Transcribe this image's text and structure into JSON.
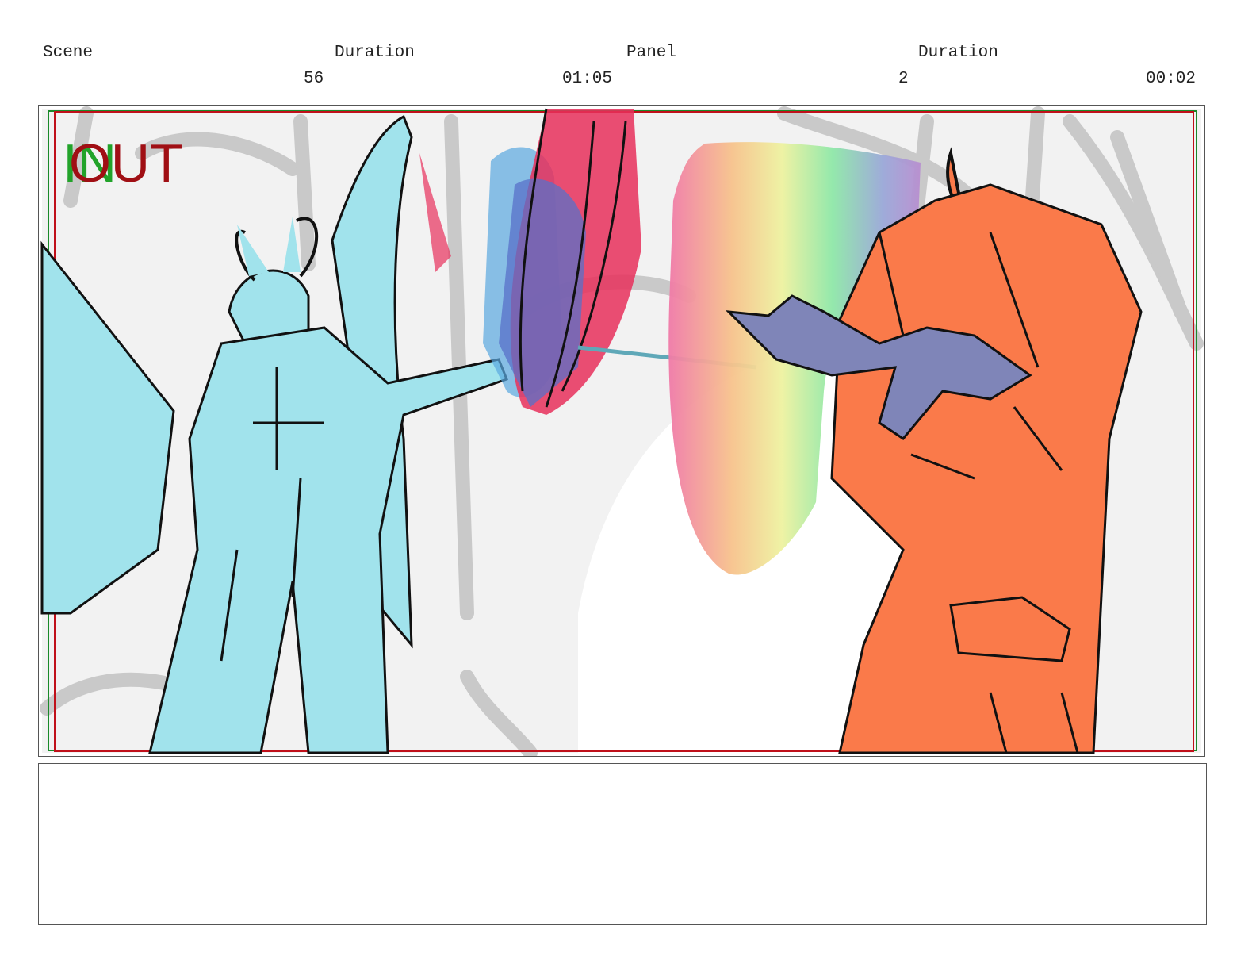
{
  "header": {
    "scene_label": "Scene",
    "scene_value": "56",
    "scene_duration_label": "Duration",
    "scene_duration_value": "01:05",
    "panel_label": "Panel",
    "panel_value": "2",
    "panel_duration_label": "Duration",
    "panel_duration_value": "00:02"
  },
  "frame": {
    "in_marker": "IN",
    "out_marker": "OUT",
    "colors": {
      "in_marker": "#22a32a",
      "out_marker": "#a00f14",
      "safe_area_red": "#c0101a",
      "safe_area_green": "#1a8a2a",
      "left_character": "#a1e3ec",
      "right_character": "#fa7a4a",
      "familiar": "#7f85b8"
    }
  },
  "notes": {
    "text": ""
  }
}
